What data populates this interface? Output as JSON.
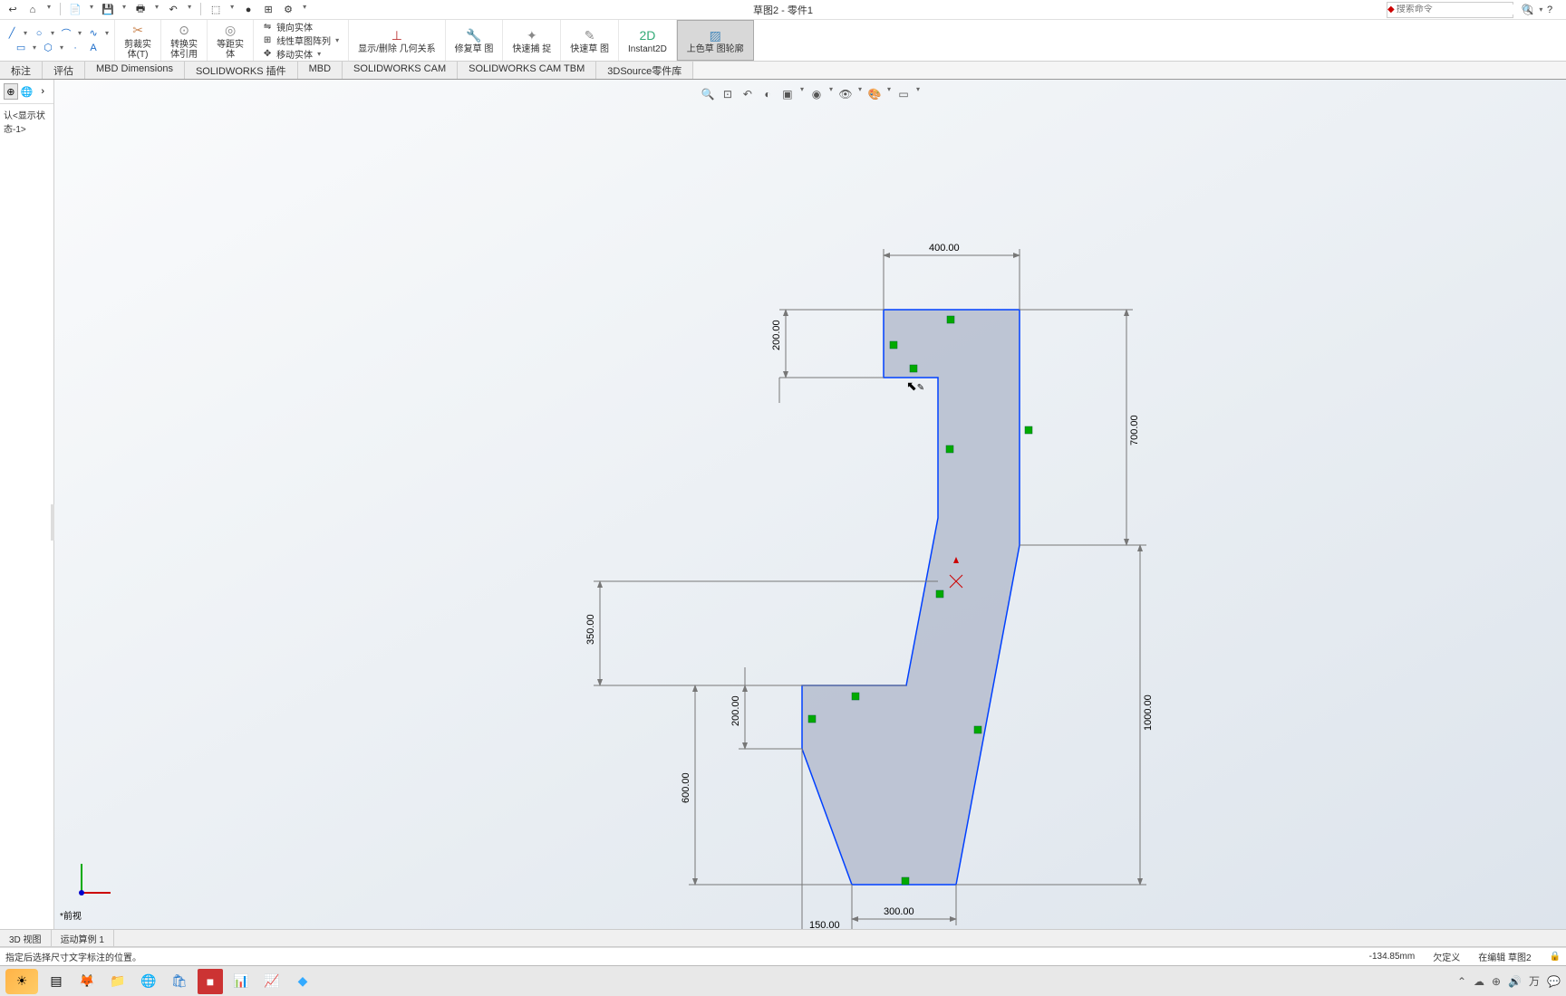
{
  "title": "草图2 - 零件1",
  "search_placeholder": "搜索命令",
  "ribbon": {
    "mirror_entity": "镜向实体",
    "linear_pattern": "线性草图阵列",
    "move_entity": "移动实体",
    "show_hide": "显示/删除\n几何关系",
    "repair": "修复草\n图",
    "quick_snap": "快速捕\n捉",
    "rapid_sketch": "快速草\n图",
    "instant2d": "Instant2D",
    "shaded_contour": "上色草\n图轮廓"
  },
  "tabs": [
    "标注",
    "评估",
    "MBD Dimensions",
    "SOLIDWORKS 插件",
    "MBD",
    "SOLIDWORKS CAM",
    "SOLIDWORKS CAM TBM",
    "3DSource零件库"
  ],
  "tree_root": "认<显示状态-1>",
  "view_label": "*前视",
  "bottom_tabs": [
    "3D 视图",
    "运动算例 1"
  ],
  "status": {
    "hint": "指定后选择尺寸文字标注的位置。",
    "coord": "-134.85mm",
    "def": "欠定义",
    "mode": "在编辑 草图2"
  },
  "dims": {
    "d400": "400.00",
    "d200a": "200.00",
    "d700": "700.00",
    "d350": "350.00",
    "d200b": "200.00",
    "d600": "600.00",
    "d1000": "1000.00",
    "d150": "150.00",
    "d300": "300.00"
  }
}
